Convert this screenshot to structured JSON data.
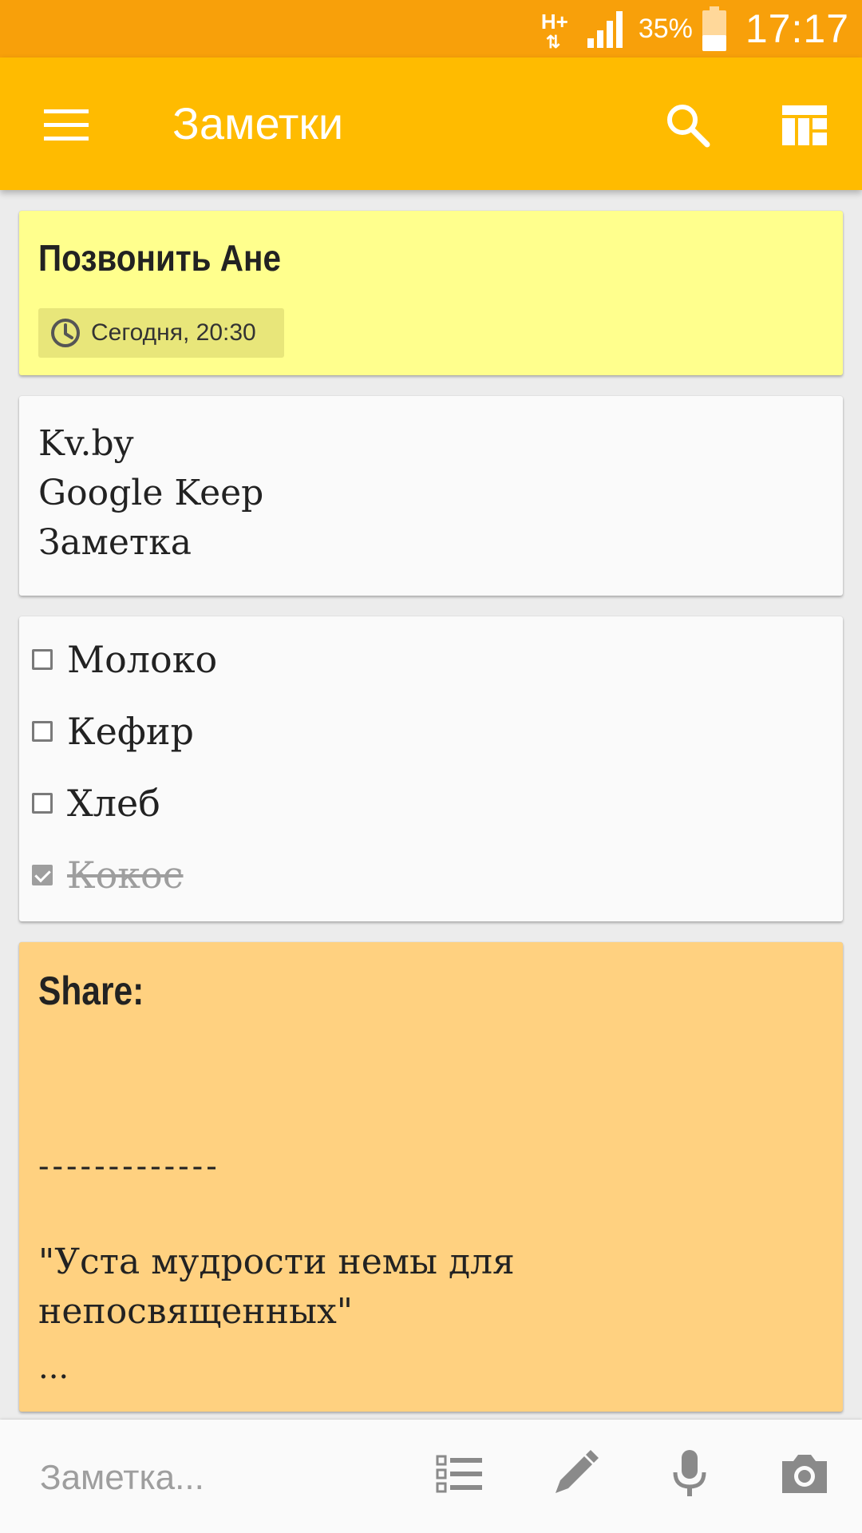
{
  "status_bar": {
    "network_type": "H+",
    "battery_percent": "35%",
    "time": "17:17"
  },
  "app_bar": {
    "title": "Заметки"
  },
  "notes": [
    {
      "title": "Позвонить Ане",
      "reminder": "Сегодня, 20:30",
      "color": "#ffff8d"
    },
    {
      "lines": [
        "Kv.by",
        "Google Keep",
        "Заметка"
      ],
      "color": "#fafafa"
    },
    {
      "items": [
        {
          "label": "Молоко",
          "checked": false
        },
        {
          "label": "Кефир",
          "checked": false
        },
        {
          "label": "Хлеб",
          "checked": false
        },
        {
          "label": "Кокос",
          "checked": true
        }
      ],
      "color": "#fafafa"
    },
    {
      "title": "Share:",
      "divider": "-------------",
      "quote": "\"Уста мудрости немы для непосвященных\"",
      "ellipsis": "...",
      "color": "#ffd180"
    }
  ],
  "bottom_bar": {
    "placeholder": "Заметка..."
  },
  "colors": {
    "status_bar": "#f8a00a",
    "app_bar": "#ffbb00"
  }
}
